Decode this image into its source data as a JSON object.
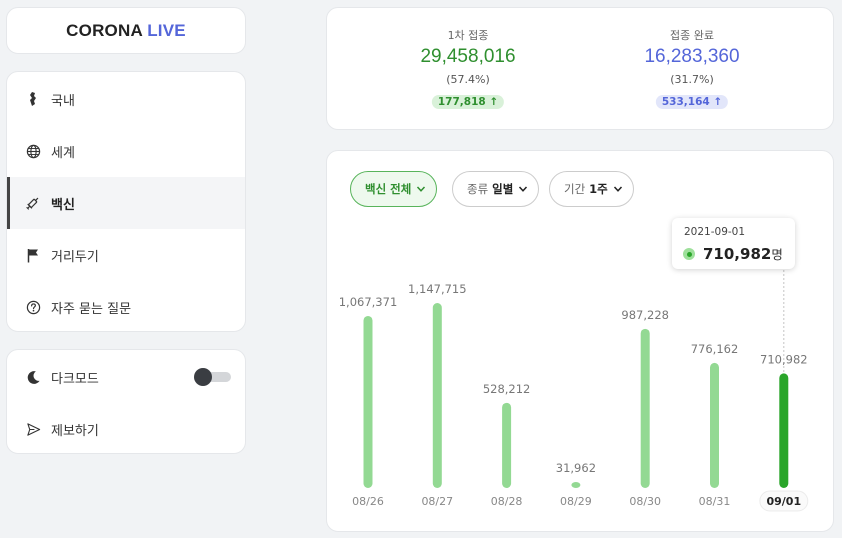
{
  "logo": {
    "part1": "CORONA ",
    "part2": "LIVE"
  },
  "nav": [
    {
      "label": "국내"
    },
    {
      "label": "세계"
    },
    {
      "label": "백신"
    },
    {
      "label": "거리두기"
    },
    {
      "label": "자주 묻는 질문"
    }
  ],
  "settings": {
    "darkmode_label": "다크모드",
    "report_label": "제보하기",
    "darkmode_on": false
  },
  "stats": {
    "first": {
      "title": "1차 접종",
      "value": "29,458,016",
      "pct": "(57.4%)",
      "delta": "177,818"
    },
    "full": {
      "title": "접종 완료",
      "value": "16,283,360",
      "pct": "(31.7%)",
      "delta": "533,164"
    }
  },
  "filters": {
    "vaccine": "백신 전체",
    "kind_label": "종류",
    "kind_value": "일별",
    "period_label": "기간",
    "period_value": "1주"
  },
  "tooltip": {
    "date": "2021-09-01",
    "value": "710,982",
    "unit": "명"
  },
  "colors": {
    "bar": "#93d993",
    "bar_active": "#2aa52a",
    "first_accent": "#2f8f2f",
    "full_accent": "#5466d9"
  },
  "chart_data": {
    "type": "bar",
    "categories": [
      "08/26",
      "08/27",
      "08/28",
      "08/29",
      "08/30",
      "08/31",
      "09/01"
    ],
    "values": [
      1067371,
      1147715,
      528212,
      31962,
      987228,
      776162,
      710982
    ],
    "value_labels": [
      "1,067,371",
      "1,147,715",
      "528,212",
      "31,962",
      "987,228",
      "776,162",
      "710,982"
    ],
    "highlighted": "09/01"
  }
}
